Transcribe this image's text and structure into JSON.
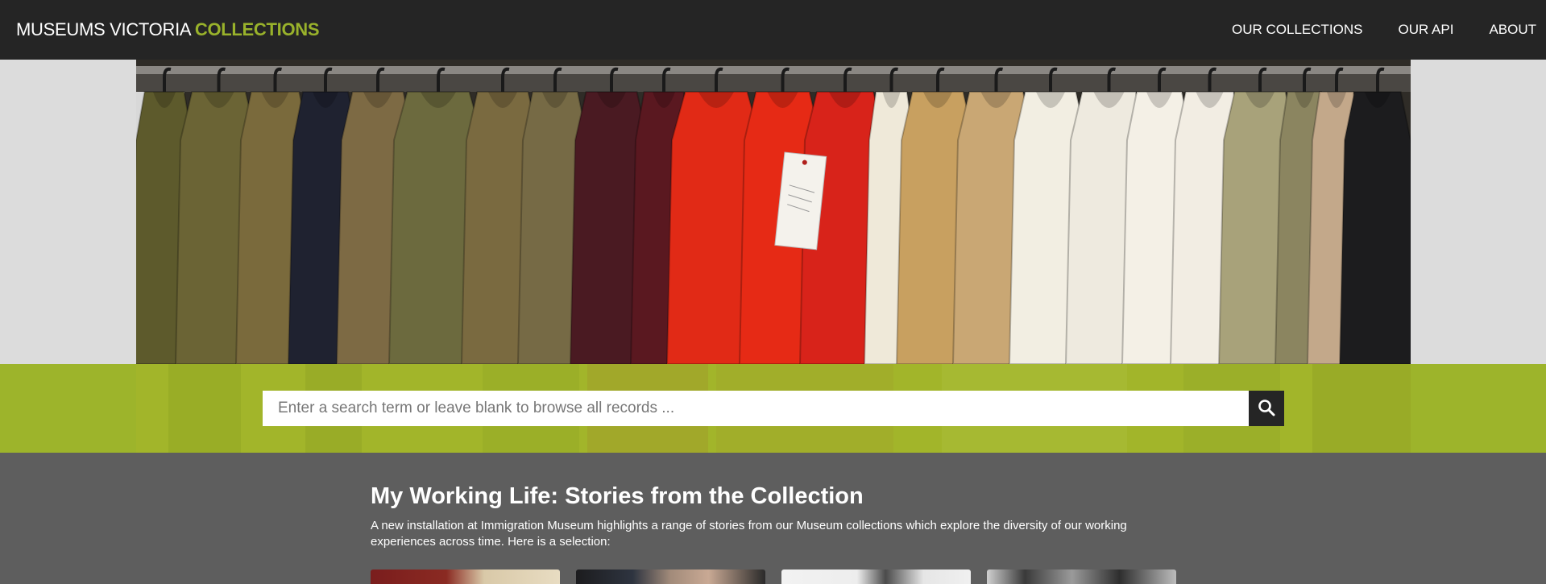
{
  "header": {
    "brand_main": "MUSEUMS VICTORIA",
    "brand_accent": "COLLECTIONS",
    "nav": [
      {
        "label": "OUR COLLECTIONS"
      },
      {
        "label": "OUR API"
      },
      {
        "label": "ABOUT"
      }
    ]
  },
  "hero": {
    "icon": "photo-of-uniforms-on-rack"
  },
  "search": {
    "placeholder": "Enter a search term or leave blank to browse all records ...",
    "value": "",
    "button_icon": "search-icon"
  },
  "feature": {
    "title": "My Working Life: Stories from the Collection",
    "description": "A new installation at Immigration Museum highlights a range of stories from our Museum collections which explore the diversity of our working experiences across time. Here is a selection:"
  },
  "colors": {
    "header_bg": "#252525",
    "accent": "#99b22b",
    "search_band": "#9db42b",
    "section_bg": "#5e5e5e"
  }
}
